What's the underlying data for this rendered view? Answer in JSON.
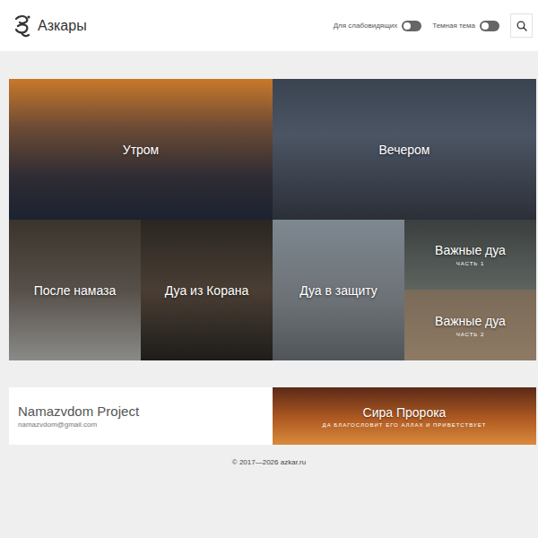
{
  "header": {
    "logo": "Азкары",
    "toggles": [
      {
        "label": "Для слабовидящих",
        "on": false
      },
      {
        "label": "Темная тема",
        "on": false
      }
    ]
  },
  "tiles": [
    {
      "title": "Утром"
    },
    {
      "title": "Вечером"
    },
    {
      "title": "После намаза"
    },
    {
      "title": "Дуа из Корана"
    },
    {
      "title": "Дуа в защиту"
    },
    {
      "title": "Важные дуа",
      "subtitle": "ЧАСТЬ 1"
    },
    {
      "title": "Важные дуа",
      "subtitle": "ЧАСТЬ 2"
    }
  ],
  "project": {
    "title": "Namazvdom Project",
    "email": "namazvdom@gmail.com"
  },
  "sira": {
    "title": "Сира Пророка",
    "subtitle": "ДА БЛАГОСЛОВИТ ЕГО АЛЛАХ И ПРИВЕТСТВУЕТ"
  },
  "footer": {
    "copyright": "© 2017—2026 azkar.ru"
  }
}
